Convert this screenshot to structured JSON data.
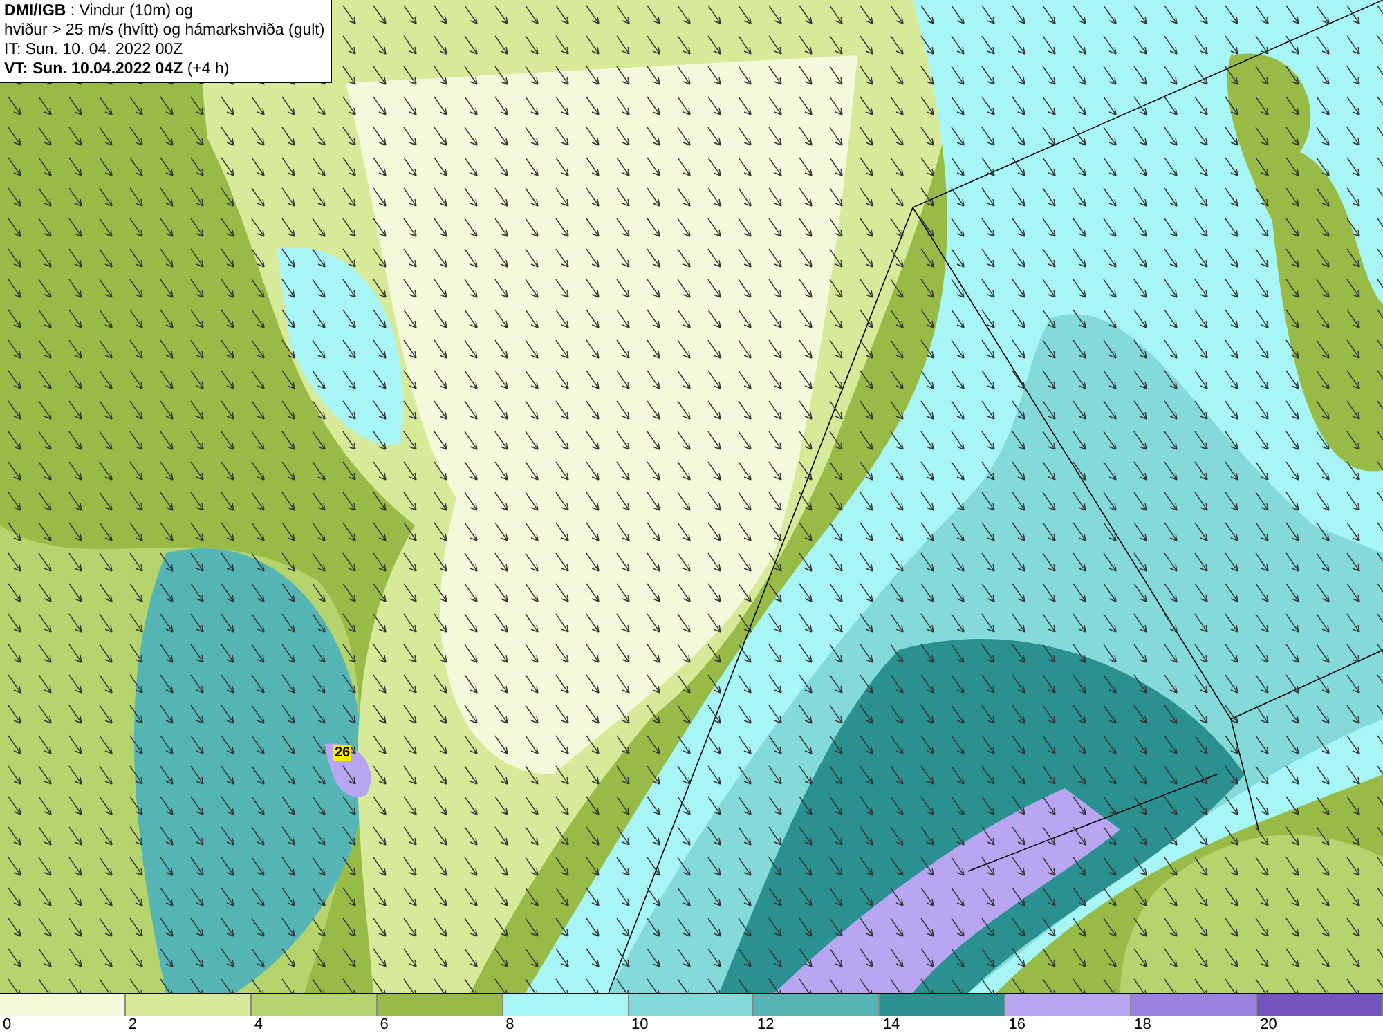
{
  "header": {
    "lines": [
      "**DMI/IGB** : Vindur (10m) og",
      "hviður > 25 m/s (hvítt) og hámarkshviða (gult)",
      "IT: Sun. 10. 04. 2022 00Z",
      "**VT: Sun. 10.04.2022 04Z** (+4 h)"
    ]
  },
  "map": {
    "gust_labels": [
      "26"
    ]
  },
  "legend": {
    "swatches": [
      {
        "color": "#f4f9dc"
      },
      {
        "color": "#d6ea9a"
      },
      {
        "color": "#b5d46e"
      },
      {
        "color": "#98bb48"
      },
      {
        "color": "#a8f5f5"
      },
      {
        "color": "#84d9d9"
      },
      {
        "color": "#55b5b5"
      },
      {
        "color": "#2a9090"
      },
      {
        "color": "#b8a6f2"
      },
      {
        "color": "#9a82e0"
      },
      {
        "color": "#7455c0"
      }
    ],
    "ticks": [
      "0",
      "2",
      "4",
      "6",
      "8",
      "10",
      "12",
      "14",
      "16",
      "18",
      "20"
    ]
  }
}
